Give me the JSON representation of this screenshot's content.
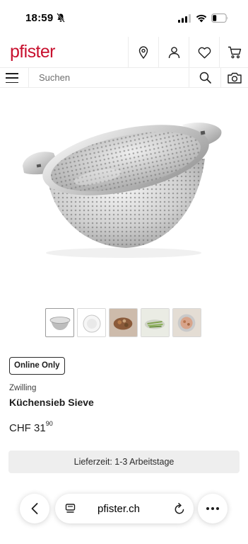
{
  "status_bar": {
    "time": "18:59"
  },
  "header": {
    "logo": "pfister"
  },
  "search": {
    "placeholder": "Suchen"
  },
  "product": {
    "badge": "Online Only",
    "brand": "Zwilling",
    "title": "Küchensieb Sieve",
    "price_main": "CHF 31",
    "price_cents": "90",
    "delivery": "Lieferzeit: 1-3 Arbeitstage",
    "thumbnail_count": 5
  },
  "browser": {
    "url": "pfister.ch"
  },
  "colors": {
    "brand": "#c8102e",
    "delivery_bg": "#eeeeee"
  }
}
